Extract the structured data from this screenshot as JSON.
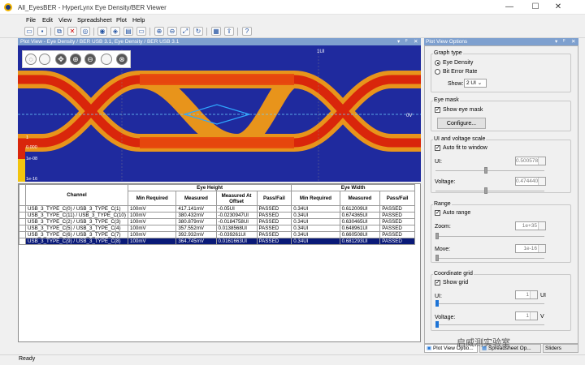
{
  "window": {
    "title": "All_EyesBER - HyperLynx Eye Density/BER Viewer",
    "controls": [
      "—",
      "☐",
      "✕"
    ]
  },
  "menu": [
    "File",
    "Edit",
    "View",
    "Spreadsheet",
    "Plot",
    "Help"
  ],
  "toolbar_icons": [
    "open-icon",
    "save-icon",
    "copy-icon",
    "delete-icon",
    "binoculars-icon",
    "eye-icon",
    "eye-settings-icon",
    "chart-icon",
    "ruler-icon",
    "zoom-icon",
    "zoom-out-icon",
    "fit-icon",
    "refresh-icon",
    "table-icon",
    "export-icon",
    "help-icon"
  ],
  "plot": {
    "header": "Plot View - Eye Density / BER USB 3.1, Eye Density / BER USB 3.1",
    "header_controls": [
      "▾",
      "ᵖ",
      "✕"
    ],
    "labels": {
      "ui": "1UI",
      "v0": "0V",
      "ber_top": "1",
      "ber_mid": "0.000",
      "ber_1e08": "1e-08",
      "ber_1e16": "1e-16"
    },
    "colors": {
      "background": "#1f2a9e",
      "hot": "#e02c0c",
      "warm": "#f29a12",
      "mask": "#2fa8ff"
    }
  },
  "table": {
    "group_headers": {
      "channel": "Channel",
      "eye_height": "Eye Height",
      "eye_width": "Eye Width"
    },
    "columns": [
      "Min Required",
      "Measured",
      "Measured At Offset",
      "Pass/Fail",
      "Min Required",
      "Measured",
      "Pass/Fail"
    ],
    "rows": [
      [
        "USB_3_TYPE_C(0) / USB_3_TYPE_C(1)",
        "100mV",
        "417.141mV",
        "-0.05UI",
        "PASSED",
        "0.34UI",
        "0.612009UI",
        "PASSED"
      ],
      [
        "USB_3_TYPE_C(11) / USB_3_TYPE_C(10)",
        "100mV",
        "380.432mV",
        "-0.0230947UI",
        "PASSED",
        "0.34UI",
        "0.674365UI",
        "PASSED"
      ],
      [
        "USB_3_TYPE_C(2) / USB_3_TYPE_C(3)",
        "100mV",
        "380.879mV",
        "-0.0184758UI",
        "PASSED",
        "0.34UI",
        "0.630465UI",
        "PASSED"
      ],
      [
        "USB_3_TYPE_C(5) / USB_3_TYPE_C(4)",
        "100mV",
        "357.552mV",
        "0.0138568UI",
        "PASSED",
        "0.34UI",
        "0.648961UI",
        "PASSED"
      ],
      [
        "USB_3_TYPE_C(6) / USB_3_TYPE_C(7)",
        "100mV",
        "392.932mV",
        "-0.039261UI",
        "PASSED",
        "0.34UI",
        "0.660508UI",
        "PASSED"
      ],
      [
        "USB_3_TYPE_C(9) / USB_3_TYPE_C(8)",
        "100mV",
        "364.745mV",
        "0.0161663UI",
        "PASSED",
        "0.34UI",
        "0.681293UI",
        "PASSED"
      ]
    ],
    "selected_row": 5
  },
  "options": {
    "header": "Plot View Options",
    "header_controls": [
      "▾",
      "ᵖ",
      "✕"
    ],
    "graph_type": {
      "title": "Graph type",
      "eye_density": "Eye Density",
      "bit_error_rate": "Bit Error Rate",
      "show_label": "Show:",
      "show_value": "2 UI",
      "selected": "eye_density"
    },
    "eye_mask": {
      "title": "Eye mask",
      "show_label": "Show eye mask",
      "configure": "Configure...",
      "show_checked": true
    },
    "scale": {
      "title": "UI and voltage scale",
      "auto_fit": "Auto fit to window",
      "auto_fit_checked": true,
      "ui_label": "UI:",
      "ui_value": "0.500578",
      "voltage_label": "Voltage:",
      "voltage_value": "0.474440"
    },
    "range": {
      "title": "Range",
      "auto_range": "Auto range",
      "auto_range_checked": true,
      "zoom_label": "Zoom:",
      "zoom_value": "1e+35",
      "move_label": "Move:",
      "move_value": "1e-16"
    },
    "grid": {
      "title": "Coordinate grid",
      "show_grid": "Show grid",
      "show_grid_checked": true,
      "ui_label": "UI:",
      "ui_value": "1",
      "ui_unit": "UI",
      "voltage_label": "Voltage:",
      "voltage_value": "1",
      "voltage_unit": "V"
    }
  },
  "tabs": [
    "Plot View Optio...",
    "Spreadsheet Op...",
    "Sliders"
  ],
  "status": "Ready",
  "watermark": "启威测实验室"
}
